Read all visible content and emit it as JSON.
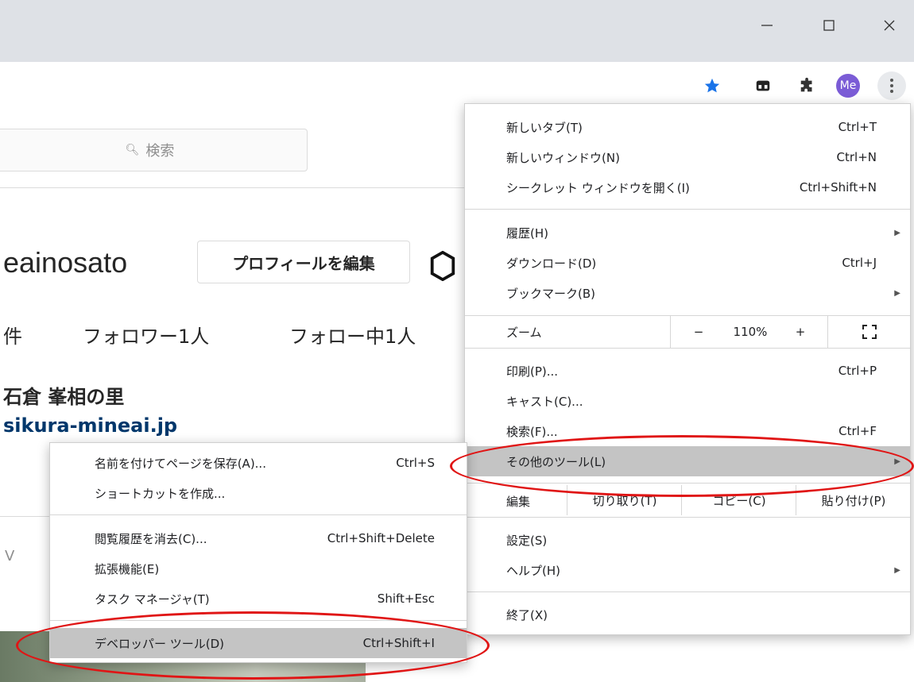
{
  "window": {
    "minimize_icon": "minimize-icon",
    "maximize_icon": "maximize-icon",
    "close_icon": "close-icon"
  },
  "toolbar": {
    "avatar_text": "Me",
    "star_color": "#1a73e8",
    "avatar_color": "#7b5cd6"
  },
  "page": {
    "search_placeholder": "検索",
    "username": "eainosato",
    "edit_profile": "プロフィールを編集",
    "stats": [
      "件",
      "フォロワー1人",
      "フォロー中1人"
    ],
    "full_name": "石倉 峯相の里",
    "website": "sikura-mineai.jp",
    "v_text": "V"
  },
  "main_menu": {
    "new_tab": {
      "label": "新しいタブ(T)",
      "shortcut": "Ctrl+T"
    },
    "new_window": {
      "label": "新しいウィンドウ(N)",
      "shortcut": "Ctrl+N"
    },
    "incognito": {
      "label": "シークレット ウィンドウを開く(I)",
      "shortcut": "Ctrl+Shift+N"
    },
    "history": {
      "label": "履歴(H)"
    },
    "downloads": {
      "label": "ダウンロード(D)",
      "shortcut": "Ctrl+J"
    },
    "bookmarks": {
      "label": "ブックマーク(B)"
    },
    "zoom": {
      "label": "ズーム",
      "minus": "−",
      "value": "110%",
      "plus": "+"
    },
    "print": {
      "label": "印刷(P)...",
      "shortcut": "Ctrl+P"
    },
    "cast": {
      "label": "キャスト(C)..."
    },
    "find": {
      "label": "検索(F)...",
      "shortcut": "Ctrl+F"
    },
    "more_tools": {
      "label": "その他のツール(L)"
    },
    "edit": {
      "label": "編集",
      "cut": "切り取り(T)",
      "copy": "コピー(C)",
      "paste": "貼り付け(P)"
    },
    "settings": {
      "label": "設定(S)"
    },
    "help": {
      "label": "ヘルプ(H)"
    },
    "exit": {
      "label": "終了(X)"
    }
  },
  "sub_menu": {
    "save_page": {
      "label": "名前を付けてページを保存(A)...",
      "shortcut": "Ctrl+S"
    },
    "create_shortcut": {
      "label": "ショートカットを作成..."
    },
    "clear_data": {
      "label": "閲覧履歴を消去(C)...",
      "shortcut": "Ctrl+Shift+Delete"
    },
    "extensions": {
      "label": "拡張機能(E)"
    },
    "task_manager": {
      "label": "タスク マネージャ(T)",
      "shortcut": "Shift+Esc"
    },
    "devtools": {
      "label": "デベロッパー ツール(D)",
      "shortcut": "Ctrl+Shift+I"
    }
  },
  "colors": {
    "highlight": "#c4c4c4",
    "annotation_ellipse": "#e01515"
  }
}
